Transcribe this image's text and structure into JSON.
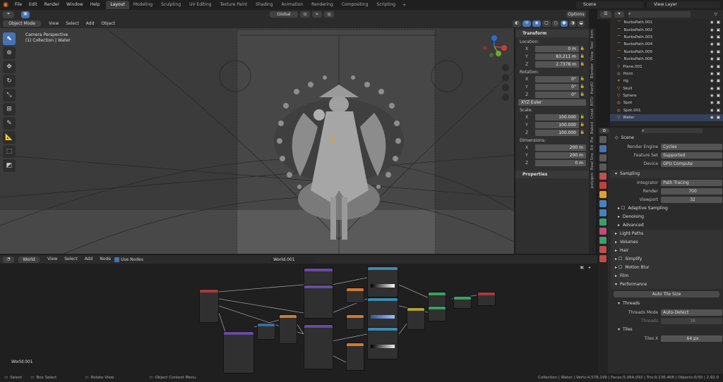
{
  "menus": [
    "File",
    "Edit",
    "Render",
    "Window",
    "Help"
  ],
  "workspaces": [
    "Layout",
    "Modeling",
    "Sculpting",
    "UV Editing",
    "Texture Paint",
    "Shading",
    "Animation",
    "Rendering",
    "Compositing",
    "Scripting"
  ],
  "scene": "Scene",
  "view_layer": "View Layer",
  "viewport": {
    "mode": "Object Mode",
    "menus": [
      "View",
      "Select",
      "Add",
      "Object"
    ],
    "orientation": "Global",
    "options": "Options",
    "camera_label": "Camera Perspective",
    "collection_label": "(1) Collection | Water"
  },
  "npanel": {
    "transform": "Transform",
    "location": "Location:",
    "loc": [
      {
        "a": "X",
        "v": "0 m"
      },
      {
        "a": "Y",
        "v": "83.211 m"
      },
      {
        "a": "Z",
        "v": "2.7378 m"
      }
    ],
    "rotation": "Rotation:",
    "rot": [
      {
        "a": "X",
        "v": "0°"
      },
      {
        "a": "Y",
        "v": "0°"
      },
      {
        "a": "Z",
        "v": "0°"
      }
    ],
    "rot_mode": "XYZ Euler",
    "scale": "Scale:",
    "scl": [
      {
        "a": "X",
        "v": "100.000"
      },
      {
        "a": "Y",
        "v": "100.000"
      },
      {
        "a": "Z",
        "v": "100.000"
      }
    ],
    "dimensions": "Dimensions:",
    "dim": [
      {
        "a": "X",
        "v": "200 m"
      },
      {
        "a": "Y",
        "v": "200 m"
      },
      {
        "a": "Z",
        "v": "0 m"
      }
    ],
    "properties": "Properties",
    "tabs": [
      "Item",
      "Tool",
      "View",
      "Blender",
      "HardO",
      "BITO",
      "Creat",
      "Baked",
      "Pie",
      "Ed",
      "Real Sno",
      "polygon"
    ]
  },
  "outliner": [
    {
      "name": "NurbsPath.001",
      "sel": false
    },
    {
      "name": "NurbsPath.002",
      "sel": false
    },
    {
      "name": "NurbsPath.003",
      "sel": false
    },
    {
      "name": "NurbsPath.004",
      "sel": false
    },
    {
      "name": "NurbsPath.005",
      "sel": false
    },
    {
      "name": "NurbsPath.006",
      "sel": false
    },
    {
      "name": "Plane.001",
      "sel": false
    },
    {
      "name": "Point",
      "sel": false
    },
    {
      "name": "rig",
      "sel": false
    },
    {
      "name": "Skull",
      "sel": false
    },
    {
      "name": "Sphere",
      "sel": false
    },
    {
      "name": "Spot",
      "sel": false
    },
    {
      "name": "Spot.001",
      "sel": false
    },
    {
      "name": "Water",
      "sel": true
    }
  ],
  "props": {
    "scene": "Scene",
    "render_engine_label": "Render Engine",
    "render_engine": "Cycles",
    "feature_set_label": "Feature Set",
    "feature_set": "Supported",
    "device_label": "Device",
    "device": "GPU Compute",
    "sampling": "Sampling",
    "integrator_label": "Integrator",
    "integrator": "Path Tracing",
    "render_label": "Render",
    "render": "700",
    "viewport_label": "Viewport",
    "viewport": "32",
    "adaptive": "Adaptive Sampling",
    "denoising": "Denoising",
    "advanced": "Advanced",
    "light_paths": "Light Paths",
    "volumes": "Volumes",
    "hair": "Hair",
    "simplify": "Simplify",
    "motion_blur": "Motion Blur",
    "film": "Film",
    "performance": "Performance",
    "auto_tile": "Auto Tile Size",
    "threads": "Threads",
    "threads_mode_label": "Threads Mode",
    "threads_mode": "Auto-Detect",
    "threads_label": "Threads",
    "threads_val": "16",
    "tiles": "Tiles",
    "tiles_x_label": "Tiles X",
    "tiles_x": "64 px"
  },
  "node_editor": {
    "type": "World",
    "menus": [
      "View",
      "Select",
      "Add",
      "Node"
    ],
    "use_nodes": "Use Nodes",
    "datablock": "World.001",
    "label": "World.001"
  },
  "status": {
    "select": "Select",
    "box_select": "Box Select",
    "rotate": "Rotate View",
    "context": "Object Context Menu",
    "stats": "Collection | Water | Verts:4,578,199 | Faces:5,064,092 | Tris:9,136,468 | Objects:0/30 | 2.92.0"
  },
  "colors": {
    "accent": "#4772b3",
    "header": "#2b2b2b",
    "viewport_bg": "#3b3b3b"
  }
}
